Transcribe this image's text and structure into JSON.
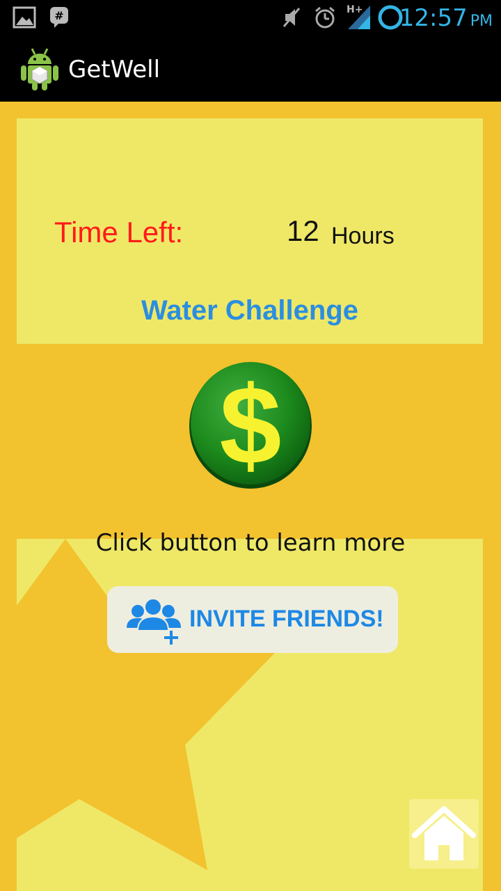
{
  "status_bar": {
    "time": "12:57",
    "ampm": "PM",
    "network_label": "H+",
    "icons": [
      "gallery-icon",
      "messenger-icon",
      "mute-icon",
      "alarm-icon",
      "signal-icon",
      "sync-icon"
    ]
  },
  "action_bar": {
    "title": "GetWell",
    "icon": "android-robot-icon"
  },
  "challenge": {
    "time_left_label": "Time Left:",
    "time_left_value": "12",
    "time_left_unit": "Hours",
    "name": "Water Challenge"
  },
  "coin_button": {
    "icon": "dollar-coin-icon",
    "colors": {
      "coin": "#1e8a1e",
      "symbol": "#f6f230"
    }
  },
  "hint": "Click button to learn more",
  "invite_button": {
    "label": "INVITE FRIENDS!",
    "icon": "add-friends-icon"
  },
  "home_button": {
    "icon": "home-icon"
  },
  "colors": {
    "background": "#f2c22f",
    "panel": "#efe867",
    "time_label": "#ff1a1a",
    "accent": "#2b8ee0",
    "status_time": "#33b5e5"
  }
}
